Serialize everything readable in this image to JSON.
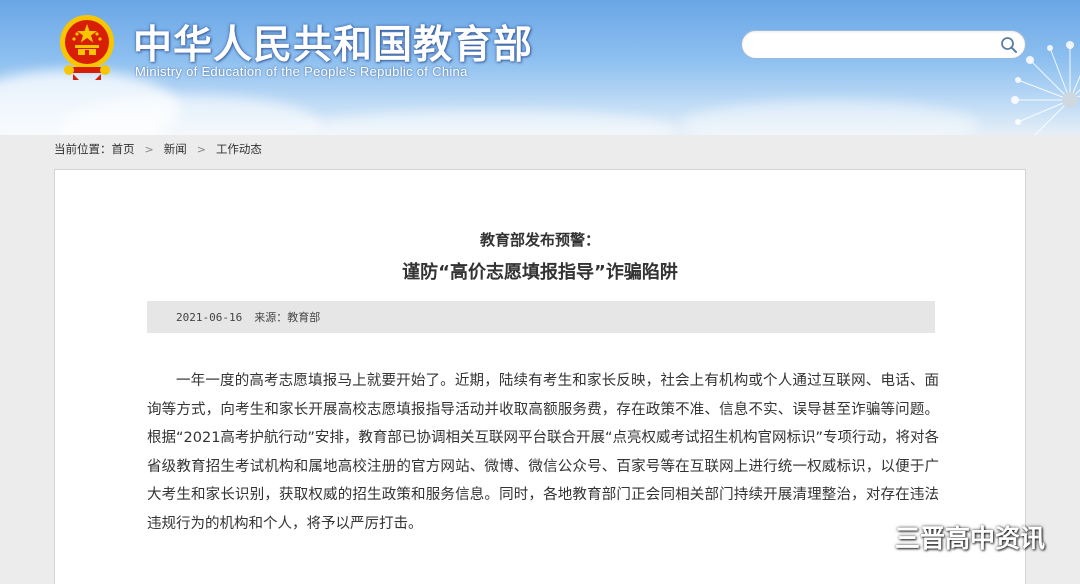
{
  "header": {
    "title": "中华人民共和国教育部",
    "subtitle": "Ministry of Education of the People's Republic of China",
    "search": {
      "placeholder": "",
      "value": ""
    }
  },
  "breadcrumb": {
    "prefix": "当前位置：",
    "items": [
      "首页",
      "新闻",
      "工作动态"
    ],
    "separator": ">"
  },
  "article": {
    "pre_title": "教育部发布预警：",
    "title": "谨防“高价志愿填报指导”诈骗陷阱",
    "date": "2021-06-16",
    "source": "来源：教育部",
    "body": "一年一度的高考志愿填报马上就要开始了。近期，陆续有考生和家长反映，社会上有机构或个人通过互联网、电话、面询等方式，向考生和家长开展高校志愿填报指导活动并收取高额服务费，存在政策不准、信息不实、误导甚至诈骗等问题。根据“2021高考护航行动”安排，教育部已协调相关互联网平台联合开展“点亮权威考试招生机构官网标识”专项行动，将对各省级教育招生考试机构和属地高校注册的官方网站、微博、微信公众号、百家号等在互联网上进行统一权威标识，以便于广大考生和家长识别，获取权威的招生政策和服务信息。同时，各地教育部门正会同相关部门持续开展清理整治，对存在违法违规行为的机构和个人，将予以严厉打击。"
  },
  "watermark": {
    "icon": "wechat-icon",
    "text": "三晋高中资讯"
  },
  "colors": {
    "sky_top": "#6aa6e6",
    "emblem_red": "#d81e06",
    "emblem_gold": "#f7c600",
    "meta_bar_bg": "#e6e6e6"
  }
}
